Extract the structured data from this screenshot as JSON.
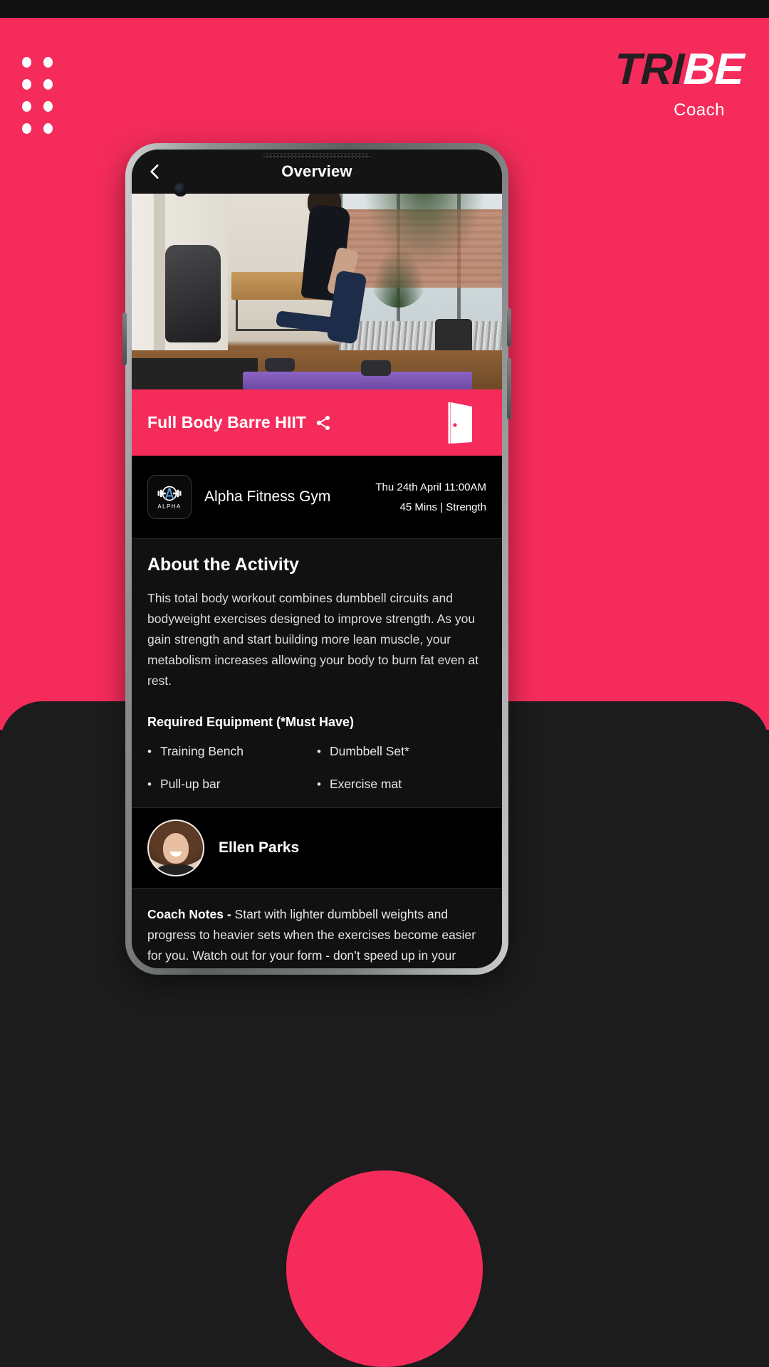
{
  "brand": {
    "logo_tri": "TRI",
    "logo_be": "BE",
    "logo_sub": "Coach",
    "accent_color": "#F52C5B",
    "dark_color": "#111111"
  },
  "app": {
    "nav": {
      "back_icon": "chevron-left-icon",
      "title": "Overview"
    },
    "hero": {
      "workout_title": "Full Body Barre HIIT",
      "share_icon": "share-icon",
      "exit_icon": "door-exit-icon"
    },
    "gym": {
      "logo_label": "ALPHA",
      "name": "Alpha Fitness Gym",
      "schedule": "Thu 24th April 11:00AM",
      "details": "45 Mins  |  Strength"
    },
    "about": {
      "heading": "About the Activity",
      "body": "This total body workout combines dumbbell circuits and bodyweight exercises designed to improve strength. As you gain strength and start building more lean muscle, your metabolism increases allowing your body  to burn fat even at rest.",
      "equipment_heading": "Required Equipment (*Must Have)",
      "equipment": [
        "Training Bench",
        "Dumbbell Set*",
        "Pull-up bar",
        "Exercise mat"
      ]
    },
    "coach": {
      "name": "Ellen Parks",
      "avatar_icon": "avatar"
    },
    "notes": {
      "label": "Coach Notes - ",
      "body": "Start with lighter dumbbell weights and progress to heavier sets when the exercises become easier for you. Watch out for your form - don’t speed up in your reps."
    }
  }
}
